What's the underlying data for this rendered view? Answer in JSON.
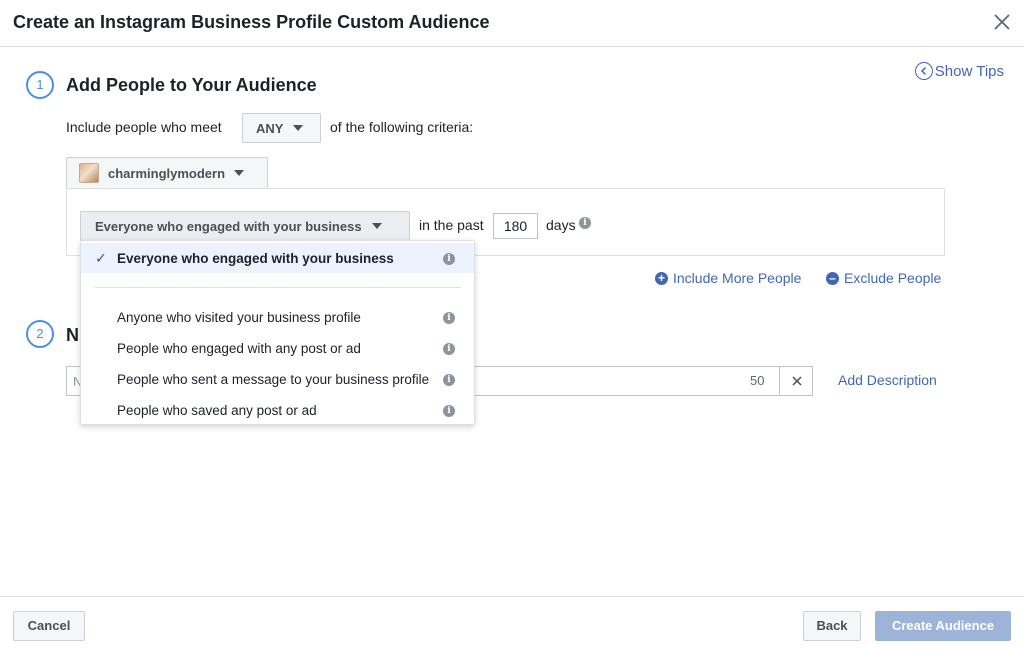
{
  "header": {
    "title": "Create an Instagram Business Profile Custom Audience"
  },
  "step1": {
    "number": "1",
    "title": "Add People to Your Audience",
    "show_tips": "Show Tips",
    "include_prefix": "Include people who meet",
    "match_value": "ANY",
    "include_suffix": "of the following criteria:",
    "account": "charminglymodern",
    "rule_value": "Everyone who engaged with your business",
    "in_the_past": "in the past",
    "days_value": "180",
    "days_label": "days",
    "include_more": "Include More People",
    "exclude": "Exclude People"
  },
  "dropdown": {
    "selected": "Everyone who engaged with your business",
    "options": [
      "Anyone who visited your business profile",
      "People who engaged with any post or ad",
      "People who sent a message to your business profile",
      "People who saved any post or ad"
    ]
  },
  "step2": {
    "number": "2",
    "title_visible": "N",
    "name_placeholder_visible": "N",
    "char_count": "50",
    "add_description": "Add Description"
  },
  "footer": {
    "cancel": "Cancel",
    "back": "Back",
    "create": "Create Audience"
  },
  "colors": {
    "accent": "#4267b2",
    "step_circle": "#4a90e2",
    "create_disabled": "#9cb4d8"
  }
}
